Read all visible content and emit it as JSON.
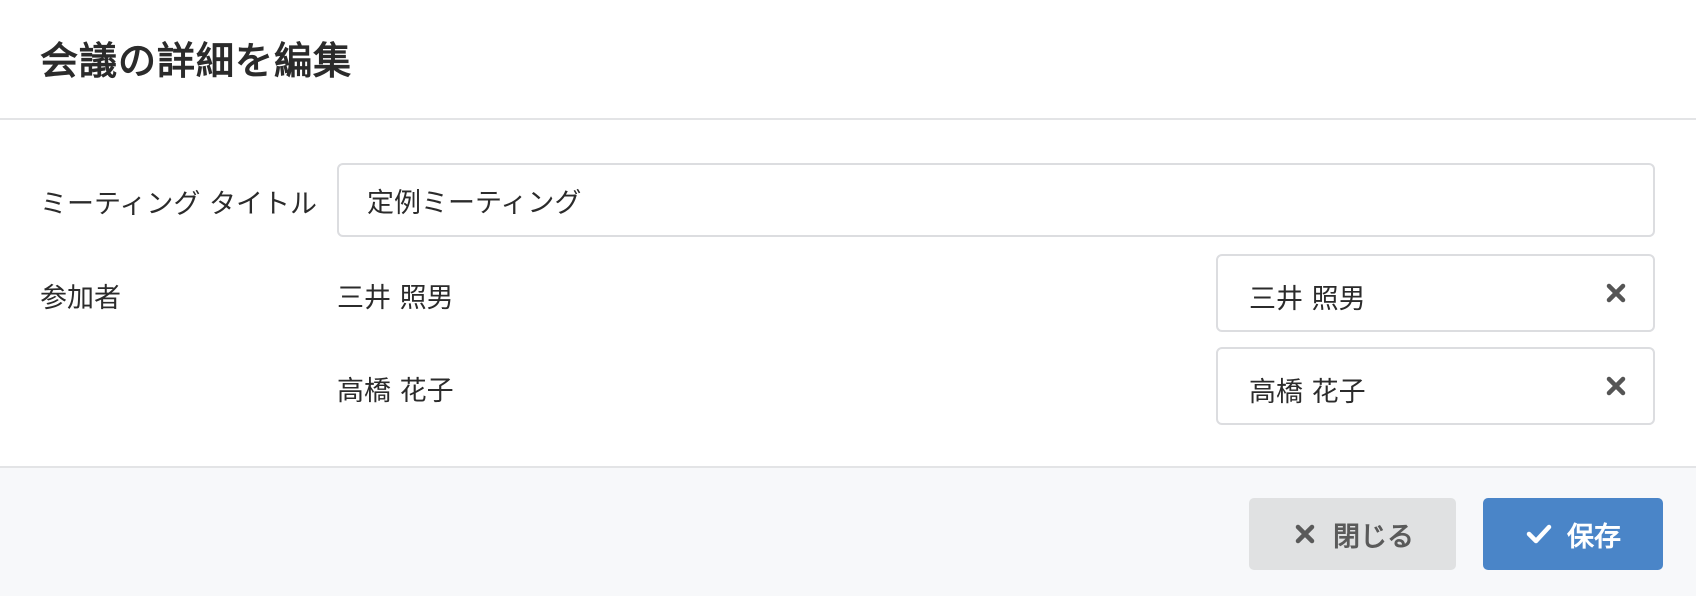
{
  "dialog": {
    "title": "会議の詳細を編集"
  },
  "form": {
    "title_label": "ミーティング タイトル",
    "title_value": "定例ミーティング",
    "participants_label": "参加者",
    "participants": [
      {
        "name": "三井 照男",
        "chip_label": "三井 照男",
        "remove_icon": "close-icon"
      },
      {
        "name": "高橋 花子",
        "chip_label": "高橋 花子",
        "remove_icon": "close-icon"
      }
    ]
  },
  "footer": {
    "close_label": "閉じる",
    "close_icon": "close-icon",
    "save_label": "保存",
    "save_icon": "check-icon"
  },
  "colors": {
    "primary": "#4a85c8",
    "secondary_button": "#e0e1e2",
    "footer_bg": "#f7f8fa",
    "border": "#dcdde0"
  }
}
